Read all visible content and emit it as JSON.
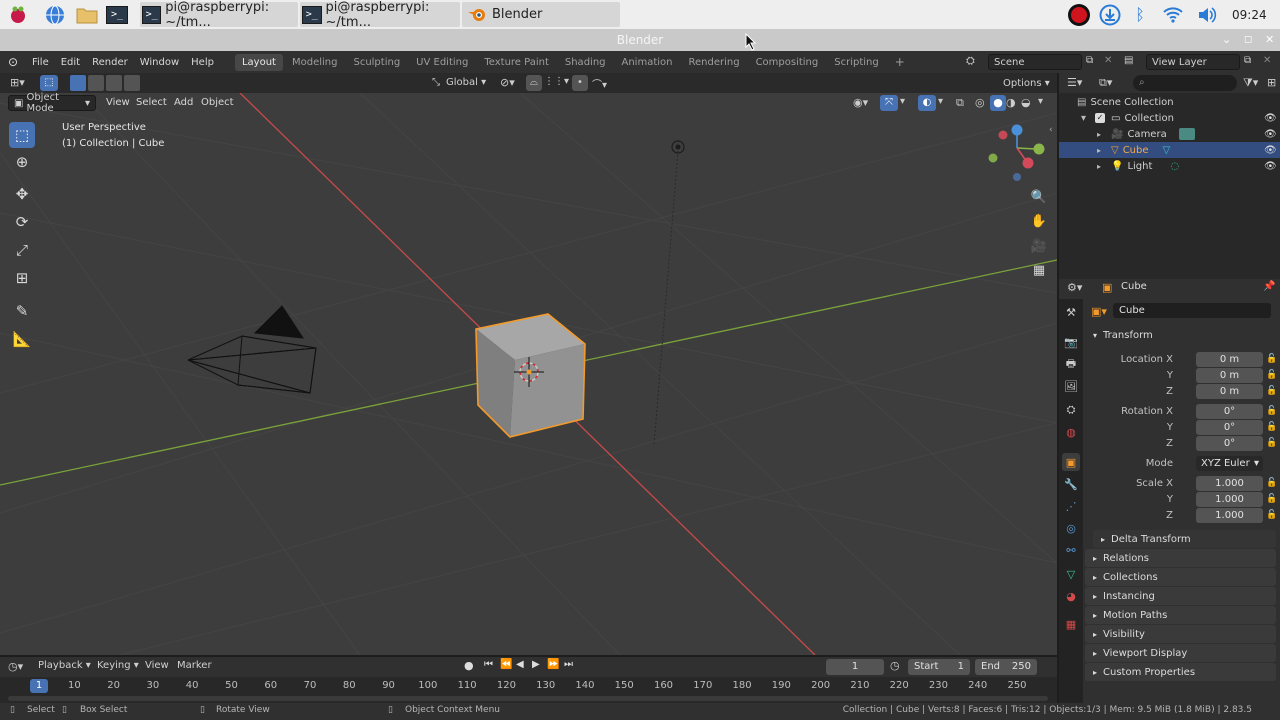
{
  "taskbar": {
    "tasks": [
      {
        "label": "pi@raspberrypi: ~/tm..."
      },
      {
        "label": "pi@raspberrypi: ~/tm..."
      },
      {
        "label": "Blender"
      }
    ],
    "clock": "09:24"
  },
  "window": {
    "title": "Blender"
  },
  "menu": {
    "items": [
      "File",
      "Edit",
      "Render",
      "Window",
      "Help"
    ]
  },
  "workspaces": [
    "Layout",
    "Modeling",
    "Sculpting",
    "UV Editing",
    "Texture Paint",
    "Shading",
    "Animation",
    "Rendering",
    "Compositing",
    "Scripting"
  ],
  "scene": {
    "name": "Scene",
    "view_layer": "View Layer"
  },
  "viewport": {
    "mode": "Object Mode",
    "menus": [
      "View",
      "Select",
      "Add",
      "Object"
    ],
    "orientation": "Global",
    "options": "Options",
    "info_line1": "User Perspective",
    "info_line2": "(1) Collection | Cube"
  },
  "outliner": {
    "scene_collection": "Scene Collection",
    "items": [
      "Collection",
      "Camera",
      "Cube",
      "Light"
    ]
  },
  "properties": {
    "object_name": "Cube",
    "datablock_name": "Cube",
    "transform_label": "Transform",
    "location_label": "Location X",
    "rotation_label": "Rotation X",
    "scale_label": "Scale X",
    "axis_y": "Y",
    "axis_z": "Z",
    "location": [
      "0 m",
      "0 m",
      "0 m"
    ],
    "rotation": [
      "0°",
      "0°",
      "0°"
    ],
    "mode_label": "Mode",
    "mode_value": "XYZ Euler",
    "scale": [
      "1.000",
      "1.000",
      "1.000"
    ],
    "delta_transform": "Delta Transform",
    "sections": [
      "Relations",
      "Collections",
      "Instancing",
      "Motion Paths",
      "Visibility",
      "Viewport Display",
      "Custom Properties"
    ]
  },
  "timeline": {
    "menus": [
      "Playback",
      "Keying",
      "View",
      "Marker"
    ],
    "current_frame": "1",
    "start_label": "Start",
    "start": "1",
    "end_label": "End",
    "end": "250",
    "ticks": [
      "10",
      "20",
      "30",
      "40",
      "50",
      "60",
      "70",
      "80",
      "90",
      "100",
      "110",
      "120",
      "130",
      "140",
      "150",
      "160",
      "170",
      "180",
      "190",
      "200",
      "210",
      "220",
      "230",
      "240",
      "250"
    ],
    "frame_marker": "1"
  },
  "statusbar": {
    "select": "Select",
    "box_select": "Box Select",
    "rotate_view": "Rotate View",
    "context_menu": "Object Context Menu",
    "stats": "Collection | Cube | Verts:8 | Faces:6 | Tris:12 | Objects:1/3 | Mem: 9.5 MiB (1.8 MiB) | 2.83.5"
  },
  "colors": {
    "accent": "#4772b3",
    "selection_outline": "#f39a2b",
    "x_axis": "#c64a4a",
    "y_axis": "#7aa33a"
  }
}
